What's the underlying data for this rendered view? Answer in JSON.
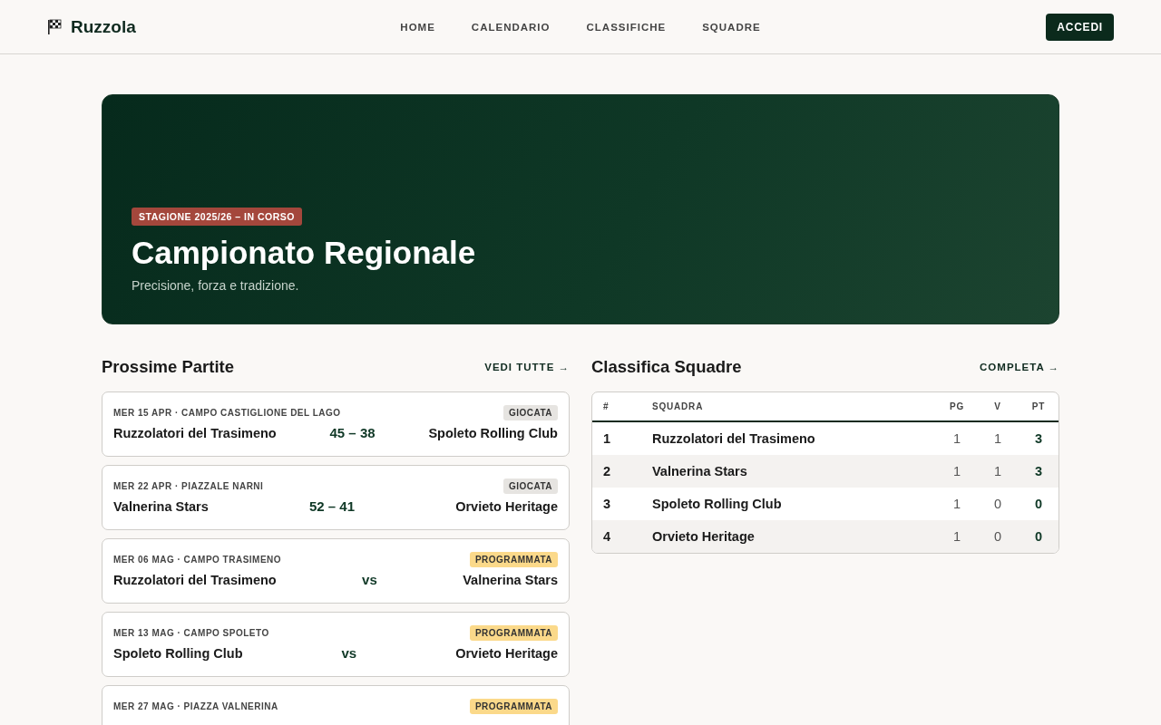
{
  "header": {
    "logo": "Ruzzola",
    "nav": [
      {
        "label": "HOME"
      },
      {
        "label": "CALENDARIO"
      },
      {
        "label": "CLASSIFICHE"
      },
      {
        "label": "SQUADRE"
      }
    ],
    "login": "ACCEDI"
  },
  "hero": {
    "badge": "STAGIONE 2025/26 – IN CORSO",
    "title": "Campionato Regionale",
    "subtitle": "Precisione, forza e tradizione."
  },
  "matches": {
    "title": "Prossime Partite",
    "link": "VEDI TUTTE →",
    "items": [
      {
        "meta": "MER 15 APR · CAMPO CASTIGLIONE DEL LAGO",
        "status": "GIOCATA",
        "kind": "played",
        "home": "Ruzzolatori del Trasimeno",
        "center": "45 – 38",
        "away": "Spoleto Rolling Club"
      },
      {
        "meta": "MER 22 APR · PIAZZALE NARNI",
        "status": "GIOCATA",
        "kind": "played",
        "home": "Valnerina Stars",
        "center": "52 – 41",
        "away": "Orvieto Heritage"
      },
      {
        "meta": "MER 06 MAG · CAMPO TRASIMENO",
        "status": "PROGRAMMATA",
        "kind": "scheduled",
        "home": "Ruzzolatori del Trasimeno",
        "center": "vs",
        "away": "Valnerina Stars"
      },
      {
        "meta": "MER 13 MAG · CAMPO SPOLETO",
        "status": "PROGRAMMATA",
        "kind": "scheduled",
        "home": "Spoleto Rolling Club",
        "center": "vs",
        "away": "Orvieto Heritage"
      },
      {
        "meta": "MER 27 MAG · PIAZZA VALNERINA",
        "status": "PROGRAMMATA",
        "kind": "scheduled"
      }
    ]
  },
  "standings": {
    "title": "Classifica Squadre",
    "link": "COMPLETA →",
    "columns": [
      "#",
      "SQUADRA",
      "PG",
      "V",
      "PT"
    ],
    "rows": [
      [
        "1",
        "Ruzzolatori del Trasimeno",
        "1",
        "1",
        "3"
      ],
      [
        "2",
        "Valnerina Stars",
        "1",
        "1",
        "3"
      ],
      [
        "3",
        "Spoleto Rolling Club",
        "1",
        "0",
        "0"
      ],
      [
        "4",
        "Orvieto Heritage",
        "1",
        "0",
        "0"
      ]
    ]
  }
}
